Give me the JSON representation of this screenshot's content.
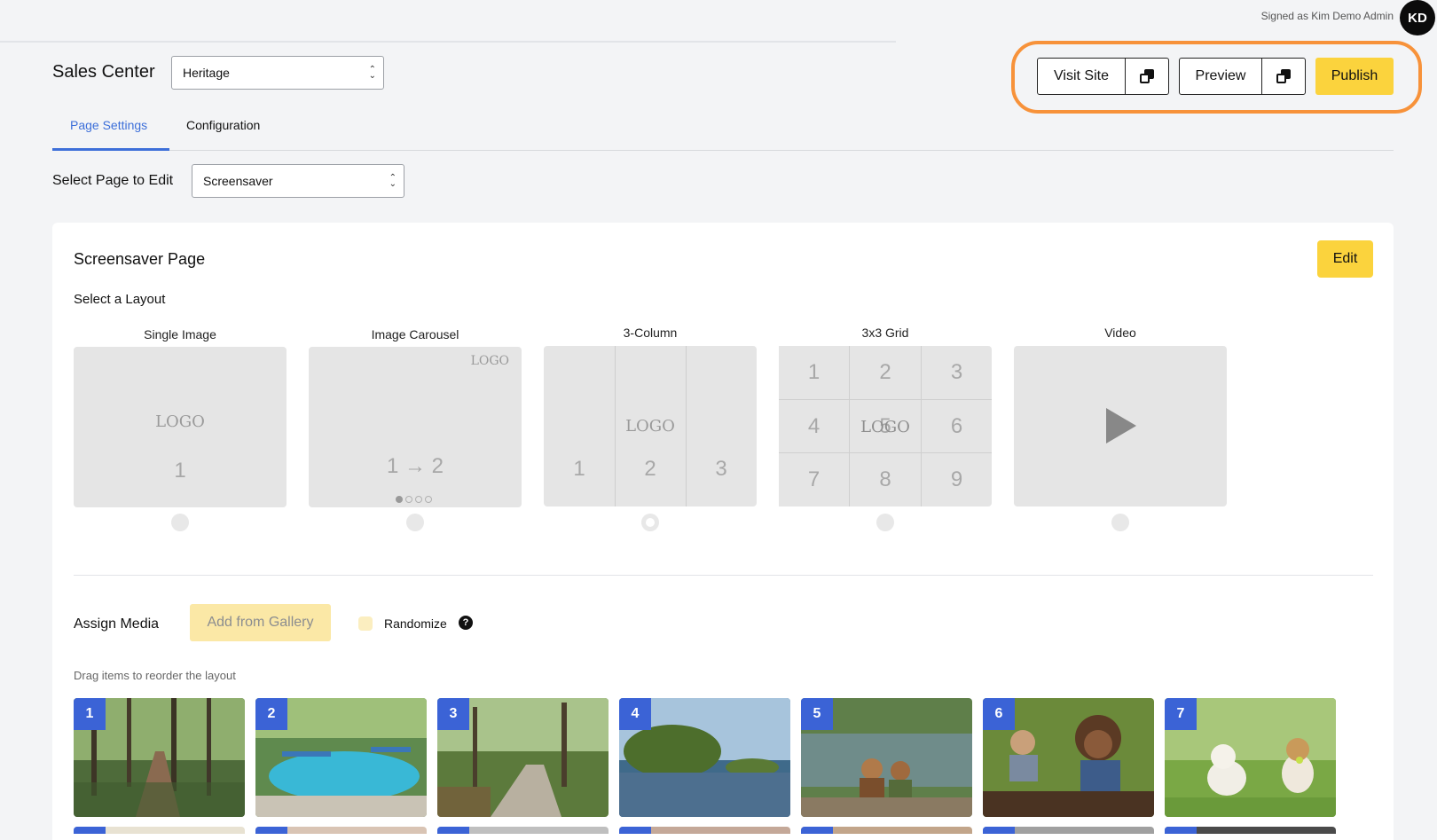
{
  "header": {
    "signed_in_text": "Signed as Kim Demo Admin",
    "avatar_initials": "KD",
    "app_title": "Sales Center",
    "site_select_value": "Heritage",
    "visit_site_label": "Visit Site",
    "preview_label": "Preview",
    "publish_label": "Publish"
  },
  "tabs": [
    {
      "label": "Page Settings",
      "active": true
    },
    {
      "label": "Configuration",
      "active": false
    }
  ],
  "page_select": {
    "label": "Select Page to Edit",
    "value": "Screensaver"
  },
  "card": {
    "title": "Screensaver Page",
    "edit_label": "Edit",
    "layout_heading": "Select a Layout",
    "layouts": [
      {
        "label": "Single Image",
        "logo": "LOGO",
        "nums": [
          "1"
        ]
      },
      {
        "label": "Image Carousel",
        "logo": "LOGO",
        "nums": [
          "1 → 2"
        ]
      },
      {
        "label": "3-Column",
        "logo": "LOGO",
        "nums": [
          "1",
          "2",
          "3"
        ],
        "selected": true
      },
      {
        "label": "3x3 Grid",
        "logo": "LOGO",
        "nums": [
          "1",
          "2",
          "3",
          "4",
          "5",
          "6",
          "7",
          "8",
          "9"
        ]
      },
      {
        "label": "Video"
      }
    ],
    "assign_media_label": "Assign Media",
    "add_gallery_label": "Add from Gallery",
    "randomize_label": "Randomize",
    "help_glyph": "?",
    "drag_hint": "Drag items to reorder the layout",
    "media": [
      {
        "num": "1"
      },
      {
        "num": "2"
      },
      {
        "num": "3"
      },
      {
        "num": "4"
      },
      {
        "num": "5"
      },
      {
        "num": "6"
      },
      {
        "num": "7"
      }
    ]
  },
  "colors": {
    "accent_yellow": "#fbd33d",
    "tab_blue": "#3d6fd9",
    "highlight_orange": "#f7923a",
    "badge_blue": "#3b63d6"
  },
  "icons": {
    "copy": "copy-icon",
    "chevron": "chevron-updown-icon",
    "help": "help-icon",
    "play": "play-icon"
  }
}
